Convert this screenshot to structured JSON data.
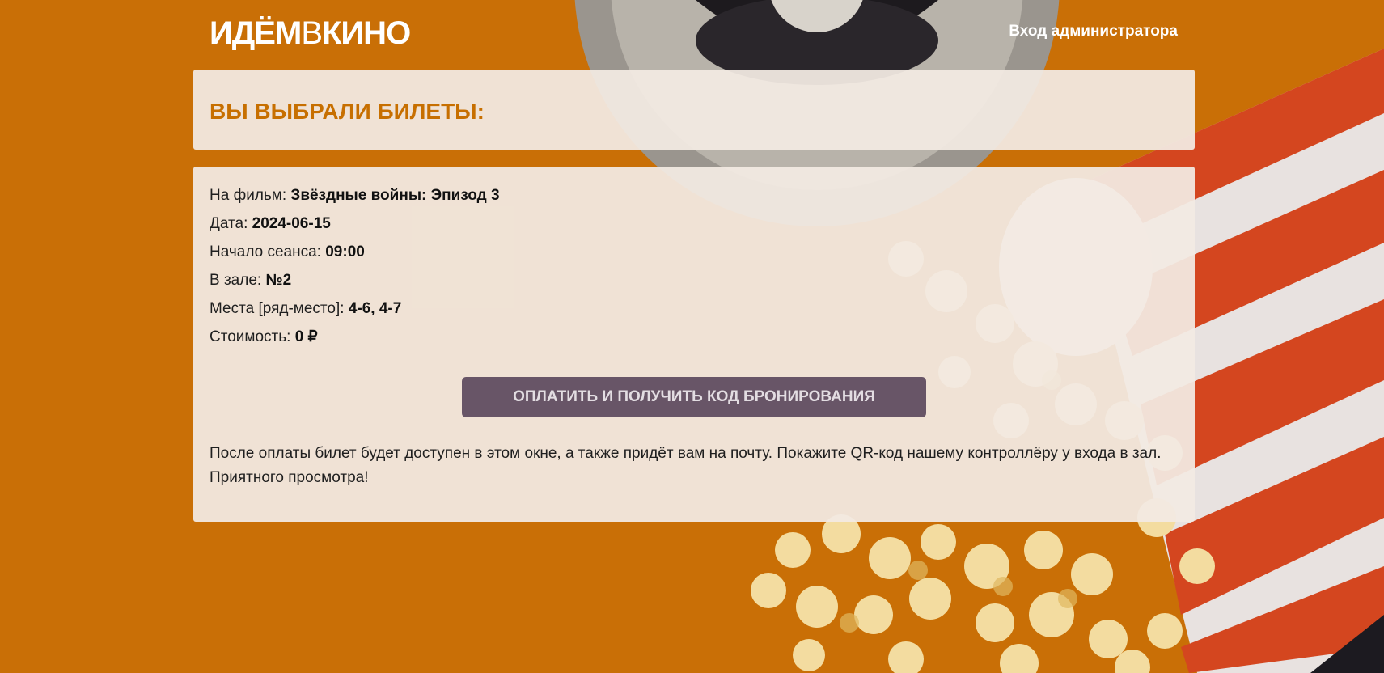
{
  "header": {
    "logo_part1": "ИДЁМ",
    "logo_part2": "В",
    "logo_part3": "КИНО",
    "admin_link": "Вход администратора"
  },
  "title_panel": {
    "heading": "ВЫ ВЫБРАЛИ БИЛЕТЫ:"
  },
  "ticket": {
    "film_label": "На фильм: ",
    "film_value": "Звёздные войны: Эпизод 3",
    "date_label": "Дата: ",
    "date_value": "2024-06-15",
    "start_label": "Начало сеанса: ",
    "start_value": "09:00",
    "hall_label": "В зале: ",
    "hall_value": "№2",
    "seats_label": "Места [ряд-место]: ",
    "seats_value": "4-6, 4-7",
    "cost_label": "Стоимость: ",
    "cost_value": "0 ₽"
  },
  "pay_button": "ОПЛАТИТЬ И ПОЛУЧИТЬ КОД БРОНИРОВАНИЯ",
  "hint": {
    "line1": "После оплаты билет будет доступен в этом окне, а также придёт вам на почту. Покажите QR-код нашему контроллёру у входа в зал.",
    "line2": "Приятного просмотра!"
  },
  "colors": {
    "background": "#c96f06",
    "accent": "#c76f00",
    "button": "#685567",
    "panel": "#f2eae2"
  }
}
